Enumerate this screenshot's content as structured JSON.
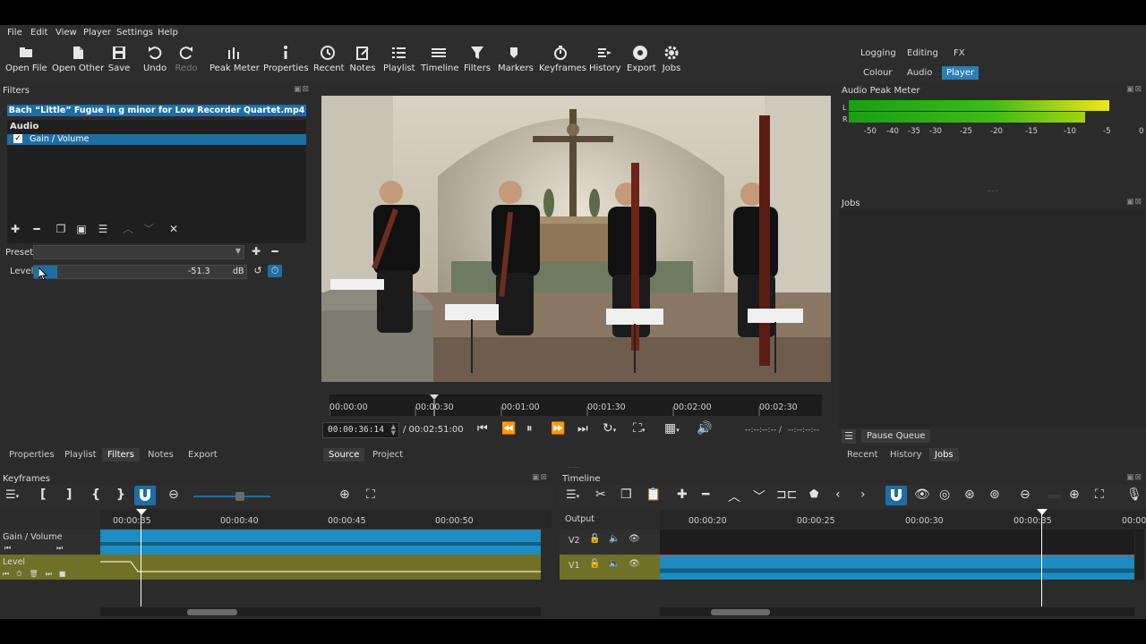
{
  "menu": [
    "File",
    "Edit",
    "View",
    "Player",
    "Settings",
    "Help"
  ],
  "toolbar": [
    {
      "label": "Open File",
      "icon": "open-file-icon"
    },
    {
      "label": "Open Other",
      "icon": "open-other-icon"
    },
    {
      "label": "Save",
      "icon": "save-icon"
    },
    {
      "label": "Undo",
      "icon": "undo-icon"
    },
    {
      "label": "Redo",
      "icon": "redo-icon"
    },
    {
      "label": "Peak Meter",
      "icon": "peak-meter-icon"
    },
    {
      "label": "Properties",
      "icon": "properties-icon"
    },
    {
      "label": "Recent",
      "icon": "recent-icon"
    },
    {
      "label": "Notes",
      "icon": "notes-icon"
    },
    {
      "label": "Playlist",
      "icon": "playlist-icon"
    },
    {
      "label": "Timeline",
      "icon": "timeline-icon"
    },
    {
      "label": "Filters",
      "icon": "filters-icon"
    },
    {
      "label": "Markers",
      "icon": "markers-icon"
    },
    {
      "label": "Keyframes",
      "icon": "keyframes-icon"
    },
    {
      "label": "History",
      "icon": "history-icon"
    },
    {
      "label": "Export",
      "icon": "export-icon"
    },
    {
      "label": "Jobs",
      "icon": "jobs-icon"
    }
  ],
  "layouts": {
    "logging": "Logging",
    "editing": "Editing",
    "fx": "FX",
    "colour": "Colour",
    "audio": "Audio",
    "player": "Player"
  },
  "filters": {
    "title": "Filters",
    "file": "Bach “Little” Fugue in g minor for Low Recorder Quartet.mp4",
    "group": "Audio",
    "item": "Gain / Volume",
    "preset_label": "Preset",
    "level_label": "Level",
    "level_value": "-51.3",
    "level_unit": "dB"
  },
  "player": {
    "ruler": [
      "00:00:00",
      "00:00:30",
      "00:01:00",
      "00:01:30",
      "00:02:00",
      "00:02:30"
    ],
    "timecode": "00:00:36:14",
    "duration": "/ 00:02:51:00",
    "in_out_a": "--:--:--:-- /",
    "in_out_b": "--:--:--:--",
    "source_tab": "Source",
    "project_tab": "Project"
  },
  "peak": {
    "title": "Audio Peak Meter",
    "l": "L",
    "r": "R",
    "scale": [
      "-50",
      "-40",
      "-35",
      "-30",
      "-25",
      "-20",
      "-15",
      "-10",
      "-5",
      "0"
    ],
    "left_level": 0.97,
    "right_level": 0.88
  },
  "jobs": {
    "title": "Jobs",
    "pause": "Pause Queue"
  },
  "left_tabs": [
    "Properties",
    "Playlist",
    "Filters",
    "Notes",
    "Export"
  ],
  "right_tabs": [
    "Recent",
    "History",
    "Jobs"
  ],
  "keyframes": {
    "title": "Keyframes",
    "ruler": [
      "00:00:35",
      "00:00:40",
      "00:00:45",
      "00:00:50"
    ],
    "track1": "Gain / Volume",
    "track2": "Level"
  },
  "timeline": {
    "title": "Timeline",
    "output": "Output",
    "ruler": [
      "00:00:20",
      "00:00:25",
      "00:00:30",
      "00:00:35",
      "00:00:"
    ],
    "v2": "V2",
    "v1": "V1"
  }
}
